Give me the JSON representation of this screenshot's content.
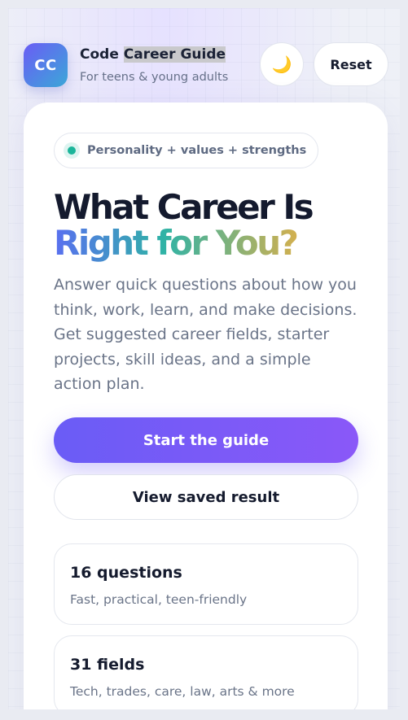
{
  "header": {
    "logo_text": "CC",
    "title_part1": "Code ",
    "title_part2": "Career Guide",
    "subtitle": "For teens & young adults",
    "theme_icon": "🌙",
    "reset_label": "Reset"
  },
  "hero": {
    "pill_text": "Personality + values + strengths",
    "headline_line1": "What Career Is",
    "headline_line2": "Right for You?",
    "description": "Answer quick questions about how you think, work, learn, and make decisions. Get suggested career fields, starter projects, skill ideas, and a simple action plan.",
    "primary_button": "Start the guide",
    "secondary_button": "View saved result"
  },
  "stats": [
    {
      "title": "16 questions",
      "description": "Fast, practical, teen-friendly"
    },
    {
      "title": "31 fields",
      "description": "Tech, trades, care, law, arts & more"
    }
  ],
  "colors": {
    "accent_purple": "#6a5cf6",
    "accent_teal": "#1bb59a",
    "text_dark": "#151b2e"
  }
}
